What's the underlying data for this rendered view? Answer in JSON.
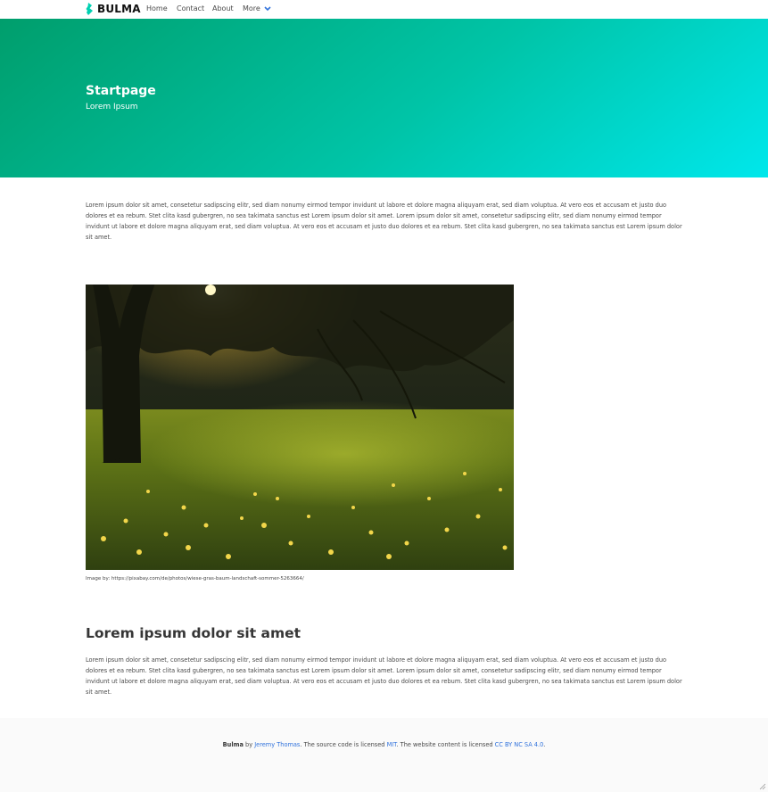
{
  "nav": {
    "brand": "BULMA",
    "items": [
      "Home",
      "Contact",
      "About"
    ],
    "more": "More"
  },
  "hero": {
    "title": "Startpage",
    "subtitle": "Lorem Ipsum"
  },
  "content": {
    "paragraph1": "Lorem ipsum dolor sit amet, consetetur sadipscing elitr, sed diam nonumy eirmod tempor invidunt ut labore et dolore magna aliquyam erat, sed diam voluptua. At vero eos et accusam et justo duo dolores et ea rebum. Stet clita kasd gubergren, no sea takimata sanctus est Lorem ipsum dolor sit amet. Lorem ipsum dolor sit amet, consetetur sadipscing elitr, sed diam nonumy eirmod tempor invidunt ut labore et dolore magna aliquyam erat, sed diam voluptua. At vero eos et accusam et justo duo dolores et ea rebum. Stet clita kasd gubergren, no sea takimata sanctus est Lorem ipsum dolor sit amet.",
    "image_caption": "Image by: https://pixabay.com/de/photos/wiese-gras-baum-landschaft-sommer-5263664/",
    "heading": "Lorem ipsum dolor sit amet",
    "paragraph2": "Lorem ipsum dolor sit amet, consetetur sadipscing elitr, sed diam nonumy eirmod tempor invidunt ut labore et dolore magna aliquyam erat, sed diam voluptua. At vero eos et accusam et justo duo dolores et ea rebum. Stet clita kasd gubergren, no sea takimata sanctus est Lorem ipsum dolor sit amet. Lorem ipsum dolor sit amet, consetetur sadipscing elitr, sed diam nonumy eirmod tempor invidunt ut labore et dolore magna aliquyam erat, sed diam voluptua. At vero eos et accusam et justo duo dolores et ea rebum. Stet clita kasd gubergren, no sea takimata sanctus est Lorem ipsum dolor sit amet."
  },
  "footer": {
    "brand": "Bulma",
    "by": " by ",
    "author": "Jeremy Thomas",
    "mid": ". The source code is licensed ",
    "code_license": "MIT",
    "mid2": ". The website content is licensed ",
    "content_license": "CC BY NC SA 4.0",
    "end": "."
  },
  "colors": {
    "hero_start": "#009e6c",
    "hero_end": "#00e7eb",
    "link": "#3273dc",
    "brand_mark": "#00d1b2"
  }
}
